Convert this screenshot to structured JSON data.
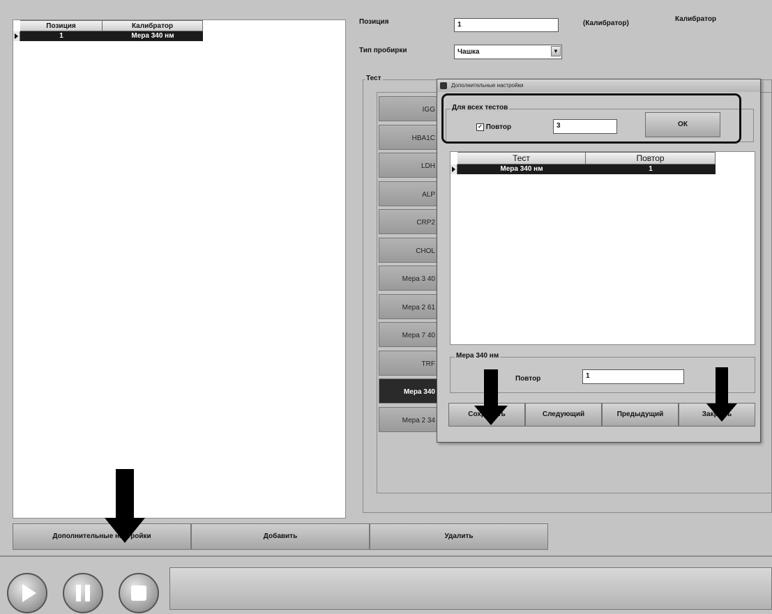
{
  "left_grid": {
    "columns": [
      "Позиция",
      "Калибратор"
    ],
    "rows": [
      {
        "position": "1",
        "calibrator": "Мера 340 нм"
      }
    ]
  },
  "form": {
    "position_label": "Позиция",
    "position_value": "1",
    "calibrator_paren": "(Калибратор)",
    "calibrator_label": "Калибратор",
    "tube_type_label": "Тип пробирки",
    "tube_type_value": "Чашка",
    "test_group_label": "Тест"
  },
  "test_tabs": [
    "IGG",
    "HBA1C",
    "LDH",
    "ALP",
    "CRP2",
    "CHOL",
    "Мера 3 40",
    "Мера 2 61",
    "Мера 7 40",
    "TRF",
    "Мера 340",
    "Мера 2 34"
  ],
  "selected_test_index": 10,
  "dialog": {
    "title": "Дополнительные настройки",
    "all_tests_group": "Для всех тестов",
    "repeat_checkbox_label": "Повтор",
    "repeat_checked": true,
    "repeat_all_value": "3",
    "ok_label": "ОК",
    "grid": {
      "columns": [
        "Тест",
        "Повтор"
      ],
      "rows": [
        {
          "test": "Мера 340 нм",
          "repeat": "1"
        }
      ]
    },
    "detail_group": "Мера 340 нм",
    "detail_repeat_label": "Повтор",
    "detail_repeat_value": "1",
    "buttons": {
      "save": "Сохранить",
      "next": "Следующий",
      "prev": "Предыдущий",
      "close": "Закрыть"
    }
  },
  "bottom_buttons": {
    "extra_settings": "Дополнительные настройки",
    "add": "Добавить",
    "delete": "Удалить"
  },
  "colors": {
    "selection": "#1b1b1b",
    "background": "#c4c4c4",
    "highlight_border": "#111111"
  },
  "icons": [
    "play-icon",
    "pause-icon",
    "stop-icon",
    "checkmark-icon",
    "dropdown-arrow-icon",
    "row-pointer-icon"
  ]
}
